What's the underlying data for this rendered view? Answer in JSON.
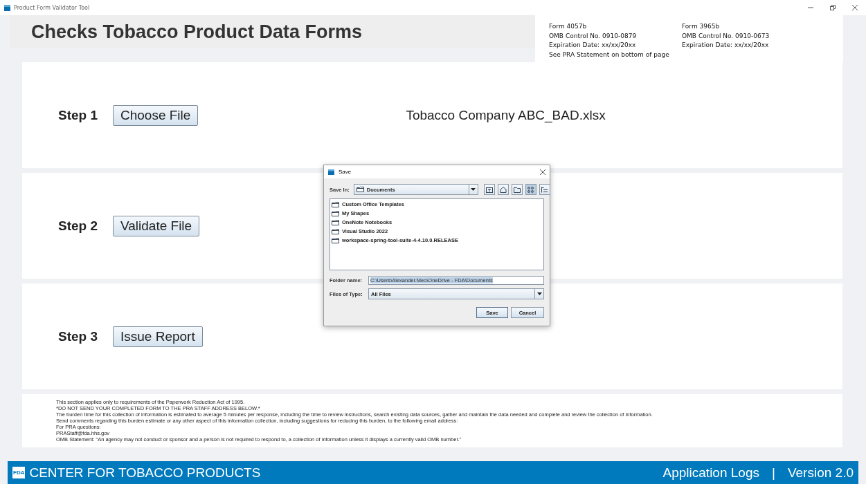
{
  "window": {
    "title": "Product Form Validator Tool"
  },
  "header": {
    "title": "Checks Tobacco Product Data Forms"
  },
  "form_info": [
    [
      "Form 4057b",
      "OMB Control No. 0910-0879",
      "Expiration Date: xx/xx/20xx",
      "See PRA Statement on bottom of page"
    ],
    [
      "Form 3965b",
      "OMB Control No. 0910-0673",
      "Expiration Date: xx/xx/20xx"
    ]
  ],
  "steps": [
    {
      "label": "Step 1",
      "button": "Choose File",
      "file": "Tobacco Company ABC_BAD.xlsx"
    },
    {
      "label": "Step 2",
      "button": "Validate File"
    },
    {
      "label": "Step 3",
      "button": "Issue Report"
    }
  ],
  "save_dialog": {
    "title": "Save",
    "save_in_label": "Save In:",
    "save_in_value": "Documents",
    "view_modes": [
      {
        "kind": "list",
        "selected": true
      },
      {
        "kind": "details",
        "selected": false
      }
    ],
    "files": [
      "Custom Office Templates",
      "My Shapes",
      "OneNote Notebooks",
      "Visual Studio 2022",
      "workspace-spring-tool-suite-4-4.10.0.RELEASE"
    ],
    "folder_name_label": "Folder name:",
    "folder_name_value": "C:\\Users\\Alexander.Meo\\OneDrive - FDA\\Documents",
    "files_of_type_label": "Files of Type:",
    "files_of_type_value": "All Files",
    "buttons": [
      "Save",
      "Cancel"
    ]
  },
  "pra_statement": [
    "This section applies only to requirements of the Paperwork Reduction Act of 1995.",
    "*DO NOT SEND YOUR COMPLETED FORM TO THE PRA STAFF ADDRESS BELOW.*",
    "The burden time for this collection of information is estimated to average 5 minutes per response, including the time to review instructions, search existing data sources, gather and maintain the data needed and complete and review the collection of information.",
    "Send comments regarding this burden estimate or any other aspect of this information collection, including suggestions for reducing this burden, to the following email address:",
    "For PRA questions:",
    "PRAStaff@fda.hhs.gov",
    "OMB Statement: \"An agency may not conduct or sponsor and a person is not required to respond to, a collection of information unless it displays a currently valid OMB number.\""
  ],
  "footer": {
    "logo": "FDA",
    "brand": "CENTER FOR TOBACCO PRODUCTS",
    "links": [
      "Application Logs",
      "Version 2.0"
    ],
    "separator": "|"
  }
}
